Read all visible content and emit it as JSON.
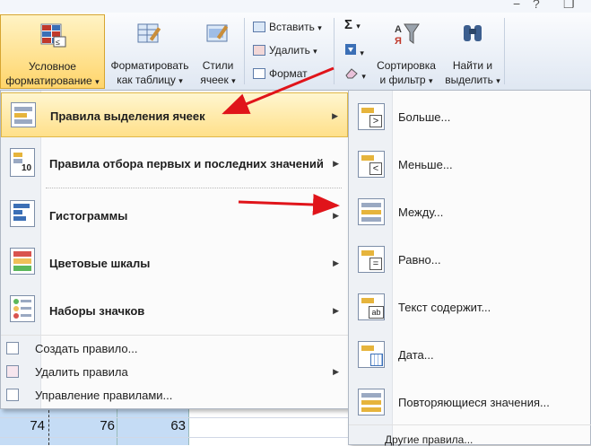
{
  "ribbon": {
    "conditional_formatting": {
      "line1": "Условное",
      "line2": "форматирование"
    },
    "format_as_table": {
      "line1": "Форматировать",
      "line2": "как таблицу"
    },
    "cell_styles": {
      "line1": "Стили",
      "line2": "ячеек"
    },
    "insert": "Вставить",
    "delete": "Удалить",
    "format": "Формат",
    "sum_symbol": "Σ",
    "sort_filter": {
      "line1": "Сортировка",
      "line2": "и фильтр"
    },
    "find_select": {
      "line1": "Найти и",
      "line2": "выделить"
    },
    "sort_icon_letters": "АЯ",
    "dropdown_glyph": "▾"
  },
  "window_controls": {
    "minimize": "−",
    "help": "?",
    "restore": "❐"
  },
  "sheet": {
    "row_visible": [
      "74",
      "76",
      "63"
    ]
  },
  "menu": {
    "items": [
      {
        "label": "Правила выделения ячеек",
        "underline": "П",
        "rest": "равила выделения ячеек"
      },
      {
        "label": "Правила отбора первых и последних значений"
      },
      {
        "label": "Гистограммы"
      },
      {
        "label": "Цветовые шкалы"
      },
      {
        "label": "Наборы значков"
      }
    ],
    "actions": [
      {
        "label": "Создать правило..."
      },
      {
        "label": "Удалить правила"
      },
      {
        "label": "Управление правилами..."
      }
    ],
    "arrow": "▶"
  },
  "submenu": {
    "items": [
      {
        "label": "Больше...",
        "glyph": ">"
      },
      {
        "label": "Меньше...",
        "glyph": "<"
      },
      {
        "label": "Между...",
        "glyph": ""
      },
      {
        "label": "Равно...",
        "glyph": "="
      },
      {
        "label": "Текст содержит...",
        "glyph": "ab"
      },
      {
        "label": "Дата...",
        "glyph": ""
      },
      {
        "label": "Повторяющиеся значения...",
        "glyph": ""
      }
    ],
    "other": "Другие правила..."
  },
  "colors": {
    "highlight": "#ffe08a",
    "annotation_arrow": "#e0141a",
    "selection": "#c5dcf5"
  }
}
